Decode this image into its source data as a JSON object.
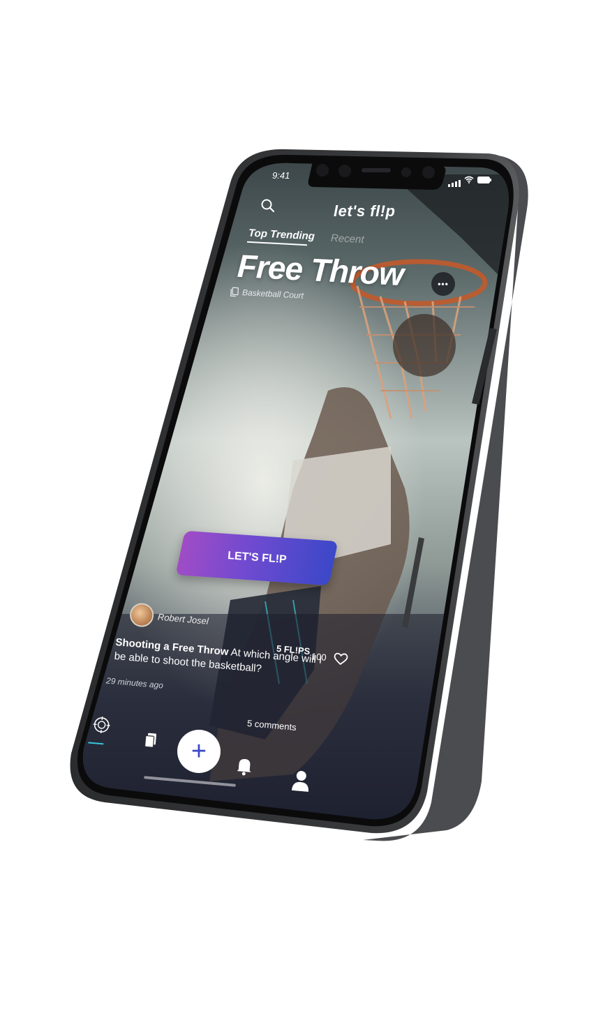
{
  "status_bar": {
    "time": "9:41"
  },
  "header": {
    "logo_text": "let's fl!p"
  },
  "tabs": [
    {
      "label": "Top Trending",
      "active": true
    },
    {
      "label": "Recent",
      "active": false
    }
  ],
  "hero": {
    "title": "Free Throw",
    "location": "Basketball Court",
    "more_label": "•••"
  },
  "cta": {
    "label": "LET'S FL!P"
  },
  "post": {
    "author": "Robert Josel",
    "flips_label": "5 FL!PS",
    "likes": "100",
    "title": "Shooting a Free Throw",
    "body": "At which angle  will I be able to shoot the basketball?",
    "time_ago": "29 minutes ago",
    "comments": "5 comments"
  },
  "bottom_nav": {
    "plus_label": "+"
  },
  "colors": {
    "accent_start": "#a04cc6",
    "accent_end": "#3b48c8",
    "nav_active": "#35c6d8"
  }
}
